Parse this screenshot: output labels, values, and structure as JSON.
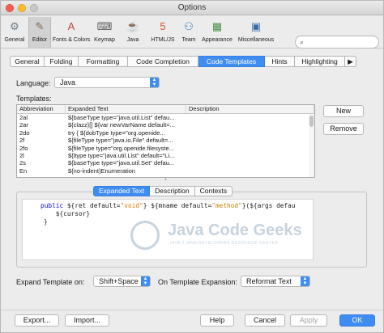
{
  "window": {
    "title": "Options"
  },
  "categories": [
    {
      "label": "General",
      "icon": "gear-icon",
      "glyph": "⚙",
      "color": "#6b7b8c",
      "selected": false
    },
    {
      "label": "Editor",
      "icon": "editor-icon",
      "glyph": "✎",
      "color": "#7d6a54",
      "selected": true
    },
    {
      "label": "Fonts & Colors",
      "icon": "fonts-colors-icon",
      "glyph": "A",
      "color": "#c2453c",
      "selected": false
    },
    {
      "label": "Keymap",
      "icon": "keyboard-icon",
      "glyph": "⌨",
      "color": "#5e5e5e",
      "selected": false
    },
    {
      "label": "Java",
      "icon": "java-icon",
      "glyph": "☕",
      "color": "#e76f00",
      "selected": false
    },
    {
      "label": "HTML/JS",
      "icon": "html5-icon",
      "glyph": "5",
      "color": "#e44d26",
      "selected": false
    },
    {
      "label": "Team",
      "icon": "team-icon",
      "glyph": "⚇",
      "color": "#2f7fc4",
      "selected": false
    },
    {
      "label": "Appearance",
      "icon": "appearance-icon",
      "glyph": "▦",
      "color": "#4a8f4a",
      "selected": false
    },
    {
      "label": "Miscellaneous",
      "icon": "miscellaneous-icon",
      "glyph": "▣",
      "color": "#3a6ea5",
      "selected": false
    }
  ],
  "search": {
    "placeholder": "",
    "icon": "search-icon"
  },
  "tabs": [
    {
      "label": "General",
      "active": false
    },
    {
      "label": "Folding",
      "active": false
    },
    {
      "label": "Formatting",
      "active": false
    },
    {
      "label": "Code Completion",
      "active": false
    },
    {
      "label": "Code Templates",
      "active": true
    },
    {
      "label": "Hints",
      "active": false
    },
    {
      "label": "Highlighting",
      "active": false
    },
    {
      "label": "▶",
      "active": false
    }
  ],
  "language": {
    "label": "Language:",
    "value": "Java"
  },
  "templates": {
    "label": "Templates:",
    "columns": [
      "Abbreviation",
      "Expanded Text",
      "Description"
    ],
    "rows": [
      [
        "2al",
        "${baseType type=\"java.util.List\" defau...",
        ""
      ],
      [
        "2ar",
        "${clazz}[] ${var newVarName default=...",
        ""
      ],
      [
        "2do",
        "try {     ${dobType type=\"org.openide...",
        ""
      ],
      [
        "2f",
        "${fileType type=\"java.io.File\" default=...",
        ""
      ],
      [
        "2fo",
        "${fileType type=\"org.openide.filesyste...",
        ""
      ],
      [
        "2l",
        "${ltype type=\"java.util.List\" default=\"Li...",
        ""
      ],
      [
        "2s",
        "${baseType type=\"java.util.Set\" defau...",
        ""
      ],
      [
        "En",
        "${no-indent}Enumeration",
        ""
      ]
    ]
  },
  "buttons": {
    "new": "New",
    "remove": "Remove"
  },
  "subtabs": [
    {
      "label": "Expanded Text",
      "active": true
    },
    {
      "label": "Description",
      "active": false
    },
    {
      "label": "Contexts",
      "active": false
    }
  ],
  "editor": {
    "line1_kw": "public",
    "line1_a": " ${ret default=",
    "line1_s1": "\"void\"",
    "line1_b": "} ${mname default=",
    "line1_s2": "\"method\"",
    "line1_c": "}(${args defau",
    "line2": "    ${cursor}",
    "line3": "}"
  },
  "watermark": {
    "brand": "Java Code Geeks",
    "tagline": "JAVA 2 JAVA DEVELOPERS RESOURCE CENTER"
  },
  "expand": {
    "label": "Expand Template on:",
    "value": "Shift+Space",
    "on_label": "On Template Expansion:",
    "on_value": "Reformat Text"
  },
  "footer": {
    "export": "Export...",
    "import": "Import...",
    "help": "Help",
    "cancel": "Cancel",
    "apply": "Apply",
    "ok": "OK"
  },
  "colors": {
    "accent": "#3f8cf3",
    "keyword": "#0000e6",
    "string": "#ce7b00"
  }
}
